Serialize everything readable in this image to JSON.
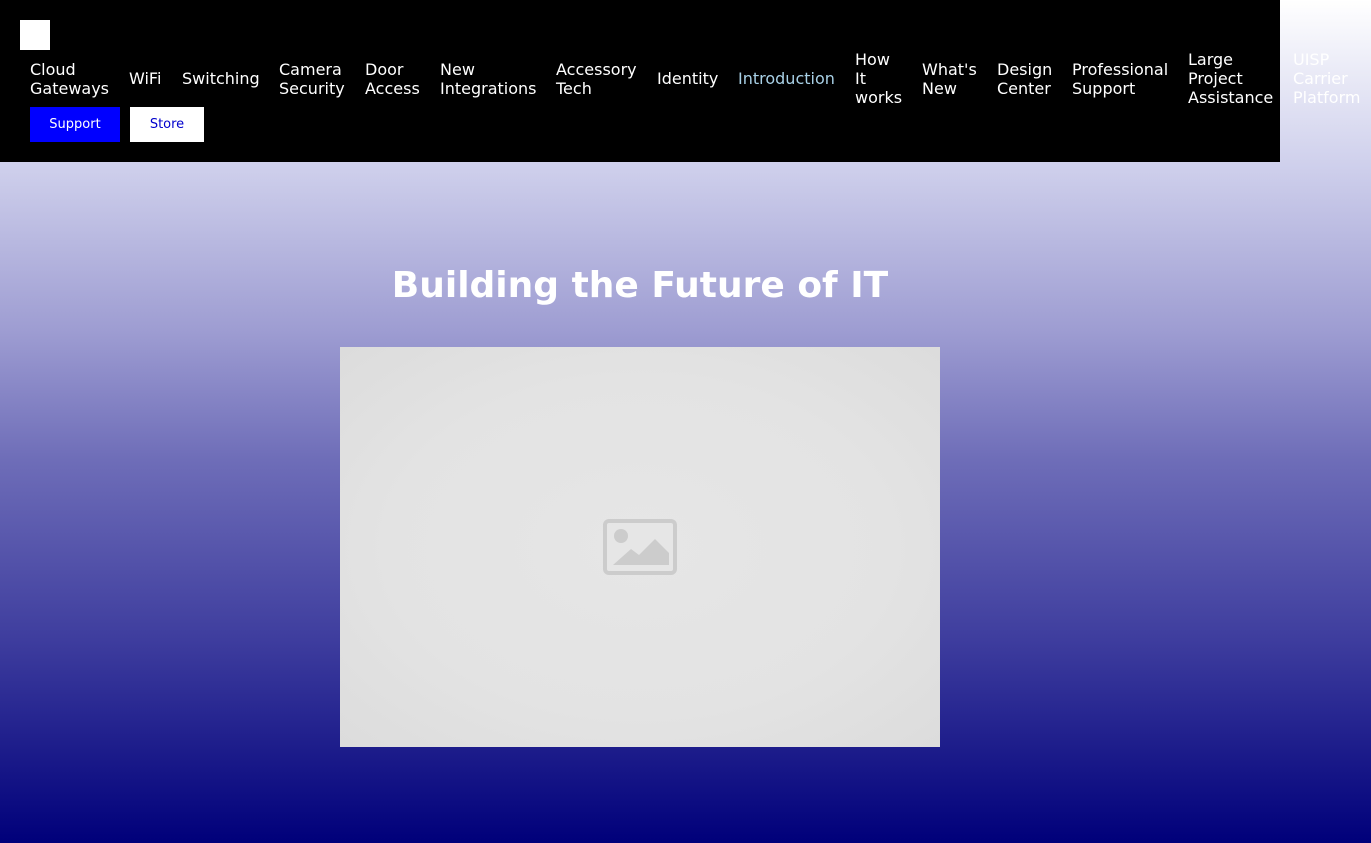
{
  "header": {
    "nav": [
      {
        "label": "Cloud\nGateways",
        "active": false
      },
      {
        "label": "WiFi",
        "active": false
      },
      {
        "label": "Switching",
        "active": false
      },
      {
        "label": "Camera\nSecurity",
        "active": false
      },
      {
        "label": "Door\nAccess",
        "active": false
      },
      {
        "label": "New\nIntegrations",
        "active": false
      },
      {
        "label": "Accessory\nTech",
        "active": false
      },
      {
        "label": "Identity",
        "active": false
      },
      {
        "label": "Introduction",
        "active": true
      },
      {
        "label": "How\nIt\nworks",
        "active": false
      },
      {
        "label": "What's\nNew",
        "active": false
      },
      {
        "label": "Design\nCenter",
        "active": false
      },
      {
        "label": "Professional\nSupport",
        "active": false
      },
      {
        "label": "Large\nProject\nAssistance",
        "active": false
      },
      {
        "label": "UISP\nCarrier\nPlatform",
        "active": false
      }
    ],
    "support_label": "Support",
    "store_label": "Store"
  },
  "hero": {
    "title": "Building the Future of IT",
    "image_icon": "image-placeholder-icon"
  },
  "colors": {
    "header_bg": "#000000",
    "active_nav": "#a8d0e6",
    "support_bg": "#0000ff",
    "gradient_bottom": "#00007a"
  }
}
